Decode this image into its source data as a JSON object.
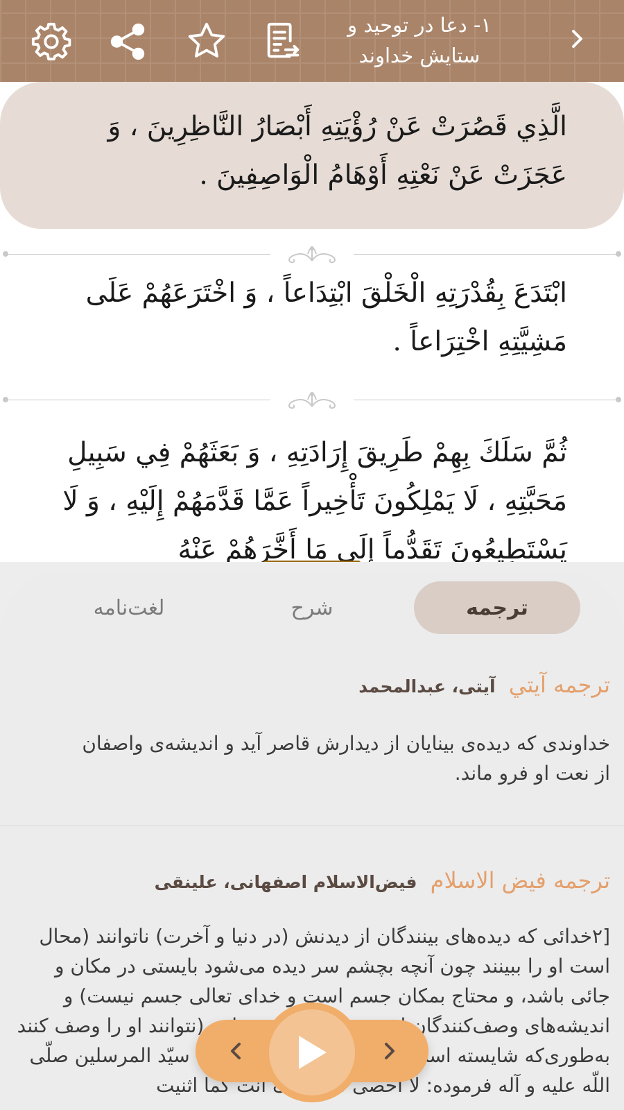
{
  "header": {
    "title": "۱- دعا در توحید و ستایش خداوند",
    "icons": [
      "gear-icon",
      "share-icon",
      "star-icon",
      "document-icon",
      "chevron-right-icon"
    ],
    "background": "#a98469"
  },
  "reader": {
    "verses": [
      "الَّذِي قَصُرَتْ عَنْ رُؤْيَتِهِ أَبْصَارُ النَّاظِرِينَ ، وَ عَجَزَتْ عَنْ نَعْتِهِ أَوْهَامُ الْوَاصِفِينَ .",
      "ابْتَدَعَ بِقُدْرَتِهِ الْخَلْقَ ابْتِدَاعاً ، وَ اخْتَرَعَهُمْ عَلَى مَشِيَّتِهِ اخْتِرَاعاً .",
      "ثُمَّ سَلَكَ بِهِمْ طَرِيقَ إِرَادَتِهِ ، وَ بَعَثَهُمْ فِي سَبِيلِ مَحَبَّتِهِ ، لَا يَمْلِكُونَ تَأْخِيراً عَمَّا قَدَّمَهُمْ إِلَيْهِ ، وَ لَا يَسْتَطِيعُونَ تَقَدُّماً إِلَى مَا أَخَّرَهُمْ عَنْهُ"
    ],
    "highlight_color": "#e6dcd5"
  },
  "tabs": [
    {
      "label": "ترجمه",
      "active": true
    },
    {
      "label": "شرح",
      "active": false
    },
    {
      "label": "لغت‌نامه",
      "active": false
    }
  ],
  "translations": [
    {
      "name": "ترجمه آیتي",
      "author": "آیتی، عبدالمحمد",
      "text": "خداوندی که دیده‌ی بینایان از دیدارش قاصر آید و اندیشه‌ی واصفان از نعت او فرو ماند."
    },
    {
      "name": "ترجمه فيض الاسلام",
      "author": "فیض‌الاسلام اصفهانی، علینقی",
      "text": "[۲خدائی که دیده‌های بینندگان از دیدنش (در دنیا و آخرت) ناتوانند (محال است او را ببینند چون آنچه بچشم سر دیده می‌شود بایستی در مکان و جائی باشد، و محتاج بمکان جسم است و خدای تعالی جسم نیست) و اندیشه‌های وصف‌کنندگان از عهدهٔ وصفش بر نیایند (نتوانند او را وصف کنند به‌طوری‌که شایسته است او را وصف نمایند، حضرت سیّد المرسلین صلّی اللّه علیه و آله فرموده: لا احصی ثناء علیک انت کما اثنیت"
    }
  ],
  "player": {
    "buttons": [
      "chevron-left-icon",
      "play-icon",
      "chevron-right-icon"
    ],
    "accent": "#f1ae6a"
  }
}
